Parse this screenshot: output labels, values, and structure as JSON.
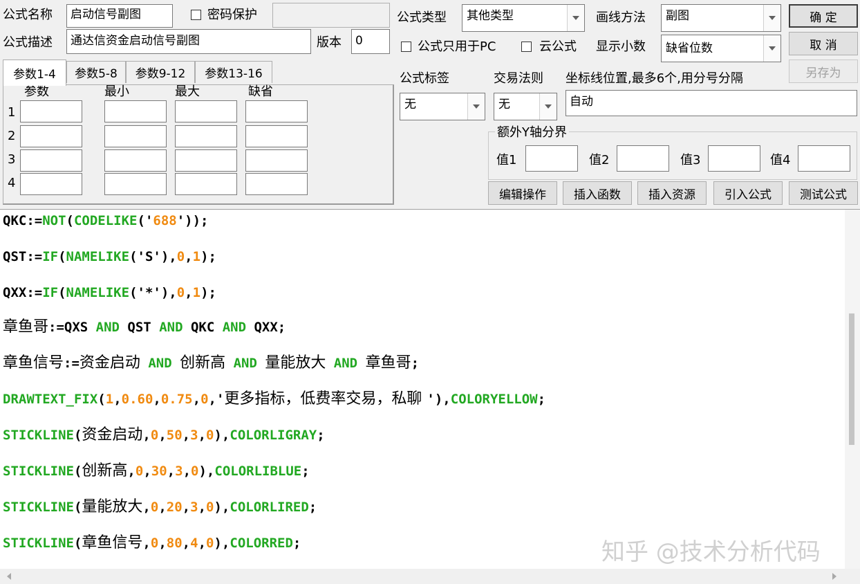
{
  "form": {
    "name_label": "公式名称",
    "name_value": "启动信号副图",
    "password_label": "密码保护",
    "password_value": "",
    "desc_label": "公式描述",
    "desc_value": "通达信资金启动信号副图",
    "version_label": "版本",
    "version_value": "0",
    "type_label": "公式类型",
    "type_value": "其他类型",
    "draw_label": "画线方法",
    "draw_value": "副图",
    "pc_only_label": "公式只用于PC",
    "cloud_label": "云公式",
    "decimals_label": "显示小数",
    "decimals_value": "缺省位数",
    "tag_label": "公式标签",
    "tag_value": "无",
    "rule_label": "交易法则",
    "rule_value": "无",
    "axis_label": "坐标线位置,最多6个,用分号分隔",
    "axis_value": "自动",
    "extra_axis_label": "额外Y轴分界",
    "values": [
      "值1",
      "值2",
      "值3",
      "值4"
    ]
  },
  "buttons": {
    "ok": "确 定",
    "cancel": "取 消",
    "save_as": "另存为",
    "edit": "编辑操作",
    "insert_func": "插入函数",
    "insert_res": "插入资源",
    "import": "引入公式",
    "test": "测试公式"
  },
  "tabs": [
    "参数1-4",
    "参数5-8",
    "参数9-12",
    "参数13-16"
  ],
  "param_headers": [
    "参数",
    "最小",
    "最大",
    "缺省"
  ],
  "param_rows": [
    "1",
    "2",
    "3",
    "4"
  ],
  "code": {
    "l1": [
      "QKC:=",
      "NOT",
      "(",
      "CODELIKE",
      "('",
      "688",
      "'));"
    ],
    "l2": [
      "QST:=",
      "IF",
      "(",
      "NAMELIKE",
      "('S'),",
      "0",
      ",",
      "1",
      ");"
    ],
    "l3": [
      "QXX:=",
      "IF",
      "(",
      "NAMELIKE",
      "('*'),",
      "0",
      ",",
      "1",
      ");"
    ],
    "l4": [
      "章鱼哥",
      ":=QXS ",
      "AND",
      " QST ",
      "AND",
      " QKC ",
      "AND",
      " QXX;"
    ],
    "l5": [
      "章鱼信号",
      ":=",
      "资金启动",
      " AND ",
      "创新高",
      " AND ",
      "量能放大",
      " AND ",
      "章鱼哥",
      ";"
    ],
    "l6": [
      "DRAWTEXT_FIX",
      "(",
      "1",
      ",",
      "0.60",
      ",",
      "0.75",
      ",",
      "0",
      ",'",
      "更多指标，低费率交易，私聊 ",
      "'),",
      "COLORYELLOW",
      ";"
    ],
    "l7": [
      "STICKLINE",
      "(",
      "资金启动",
      ",",
      "0",
      ",",
      "50",
      ",",
      "3",
      ",",
      "0",
      "),",
      "COLORLIGRAY",
      ";"
    ],
    "l8": [
      "STICKLINE",
      "(",
      "创新高",
      ",",
      "0",
      ",",
      "30",
      ",",
      "3",
      ",",
      "0",
      "),",
      "COLORLIBLUE",
      ";"
    ],
    "l9": [
      "STICKLINE",
      "(",
      "量能放大",
      ",",
      "0",
      ",",
      "20",
      ",",
      "3",
      ",",
      "0",
      "),",
      "COLORLIRED",
      ";"
    ],
    "l10": [
      "STICKLINE",
      "(",
      "章鱼信号",
      ",",
      "0",
      ",",
      "80",
      ",",
      "4",
      ",",
      "0",
      "),",
      "COLORRED",
      ";"
    ]
  },
  "watermark": "知乎 @技术分析代码",
  "colors": {
    "function": "#22a822",
    "number": "#f08a10"
  }
}
